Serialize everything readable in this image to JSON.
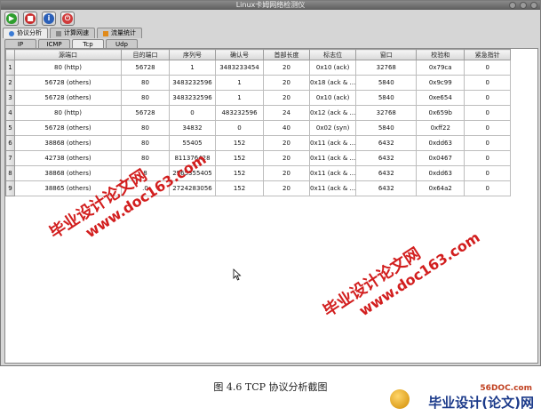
{
  "window": {
    "title": "Linux卡姆网络检测仪"
  },
  "toolbar": [
    {
      "name": "start-button",
      "icon": "play-icon",
      "color": "#2e9e2e"
    },
    {
      "name": "stop-button",
      "icon": "stop-icon",
      "color": "#c82a2a"
    },
    {
      "name": "info-button",
      "icon": "info-icon",
      "color": "#2a5fb8"
    },
    {
      "name": "power-button",
      "icon": "power-icon",
      "color": "#d03a3a"
    }
  ],
  "main_tabs": [
    {
      "label": "协议分析",
      "icon": "analysis-icon",
      "active": true
    },
    {
      "label": "计算网速",
      "icon": "speed-icon",
      "active": false
    },
    {
      "label": "流量统计",
      "icon": "stats-icon",
      "active": false
    }
  ],
  "protocol_tabs": [
    {
      "label": "IP",
      "active": false
    },
    {
      "label": "ICMP",
      "active": false
    },
    {
      "label": "Tcp",
      "active": true
    },
    {
      "label": "Udp",
      "active": false
    }
  ],
  "table": {
    "headers": [
      "源端口",
      "目的端口",
      "序列号",
      "确认号",
      "首部长度",
      "标志位",
      "窗口",
      "校验和",
      "紧急指针"
    ],
    "rows": [
      [
        "80 (http)",
        "56728",
        "1",
        "3483233454",
        "20",
        "0x10 (ack)",
        "32768",
        "0x79ca",
        "0"
      ],
      [
        "56728 (others)",
        "80",
        "3483232596",
        "1",
        "20",
        "0x18 (ack & ...",
        "5840",
        "0x9c99",
        "0"
      ],
      [
        "56728 (others)",
        "80",
        "3483232596",
        "1",
        "20",
        "0x10 (ack)",
        "5840",
        "0xe654",
        "0"
      ],
      [
        "80 (http)",
        "56728",
        "0",
        "483232596",
        "24",
        "0x12 (ack & ...",
        "32768",
        "0x659b",
        "0"
      ],
      [
        "56728 (others)",
        "80",
        "34832",
        "0",
        "40",
        "0x02 (syn)",
        "5840",
        "0xff22",
        "0"
      ],
      [
        "38868 (others)",
        "80",
        "55405",
        "152",
        "20",
        "0x11 (ack & ...",
        "6432",
        "0xdd63",
        "0"
      ],
      [
        "42738 (others)",
        "80",
        "811376428",
        "152",
        "20",
        "0x11 (ack & ...",
        "6432",
        "0x0467",
        "0"
      ],
      [
        "38868 (others)",
        "8",
        "2965355405",
        "152",
        "20",
        "0x11 (ack & ...",
        "6432",
        "0xdd63",
        "0"
      ],
      [
        "38865 (others)",
        ".0",
        "2724283056",
        "152",
        "20",
        "0x11 (ack & ...",
        "6432",
        "0x64a2",
        "0"
      ]
    ]
  },
  "watermarks": [
    {
      "line1": "毕业设计论文网",
      "line2": "www.doc163.com"
    },
    {
      "line1": "毕业设计论文网",
      "line2": "www.doc163.com"
    }
  ],
  "caption": "图 4.6 TCP 协议分析截图",
  "footer": {
    "site": "56DOC.com",
    "brand": "毕业设计(论文)网"
  }
}
